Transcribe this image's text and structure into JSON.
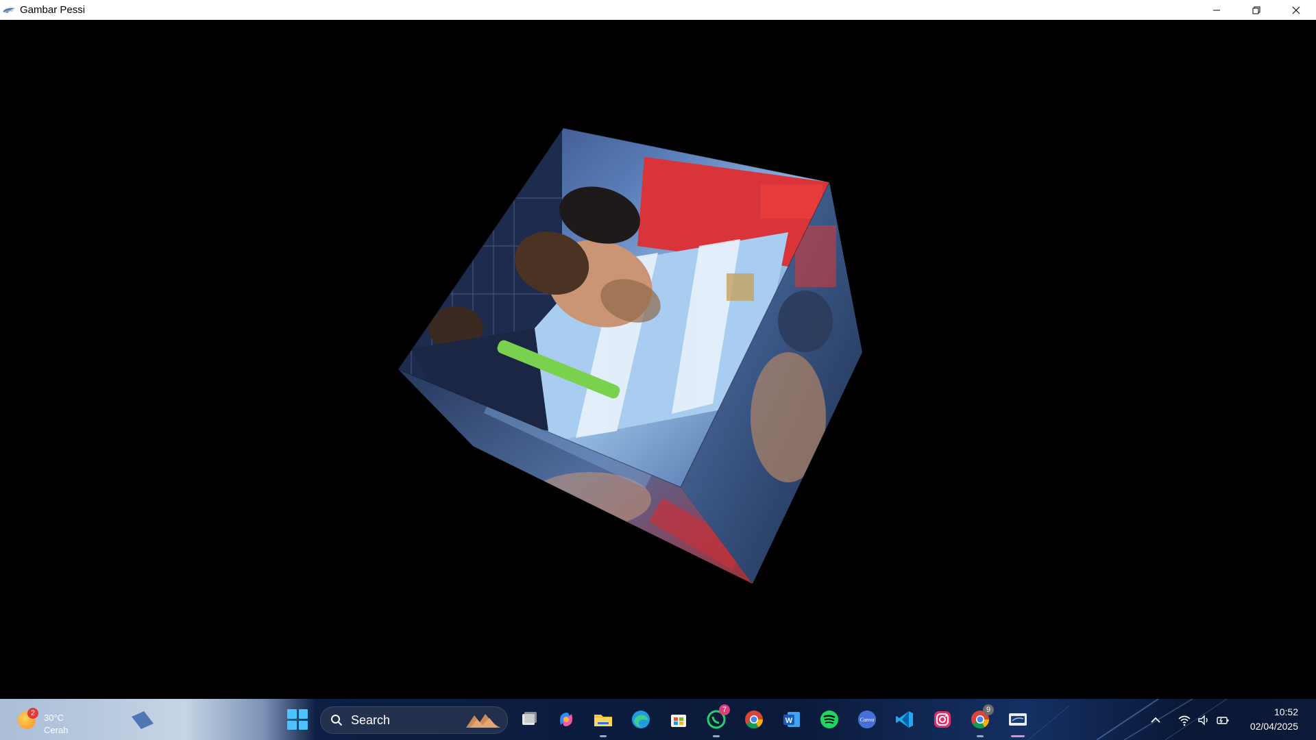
{
  "window": {
    "title": "Gambar Pessi"
  },
  "scene": {
    "background": "#000000",
    "object": "textured-rotating-cube"
  },
  "taskbar": {
    "weather": {
      "temperature": "30°C",
      "condition": "Cerah",
      "badge": "2"
    },
    "search": {
      "label": "Search"
    },
    "apps": [
      {
        "name": "Task View",
        "icon": "task-view-icon"
      },
      {
        "name": "Copilot",
        "icon": "copilot-icon"
      },
      {
        "name": "File Explorer",
        "icon": "folder-icon"
      },
      {
        "name": "Microsoft Edge",
        "icon": "edge-icon"
      },
      {
        "name": "Microsoft Store",
        "icon": "store-icon"
      },
      {
        "name": "WhatsApp",
        "icon": "whatsapp-icon",
        "badge": "7"
      },
      {
        "name": "Google Chrome",
        "icon": "chrome-icon"
      },
      {
        "name": "Microsoft Word",
        "icon": "word-icon"
      },
      {
        "name": "Spotify",
        "icon": "spotify-icon"
      },
      {
        "name": "Canva",
        "icon": "canva-icon",
        "text": "Canva"
      },
      {
        "name": "Visual Studio Code",
        "icon": "vscode-icon"
      },
      {
        "name": "Instagram",
        "icon": "instagram-icon"
      },
      {
        "name": "Google Chrome",
        "icon": "chrome-profile-icon",
        "badge": "9"
      },
      {
        "name": "Gambar Pessi",
        "icon": "opengl-app-icon"
      }
    ],
    "clock": {
      "time": "10:52",
      "date": "02/04/2025"
    }
  },
  "colors": {
    "taskbar_dark": "#0b1a3a",
    "accent_blue": "#4cc2ff",
    "active_indicator": "#e58bd0"
  }
}
